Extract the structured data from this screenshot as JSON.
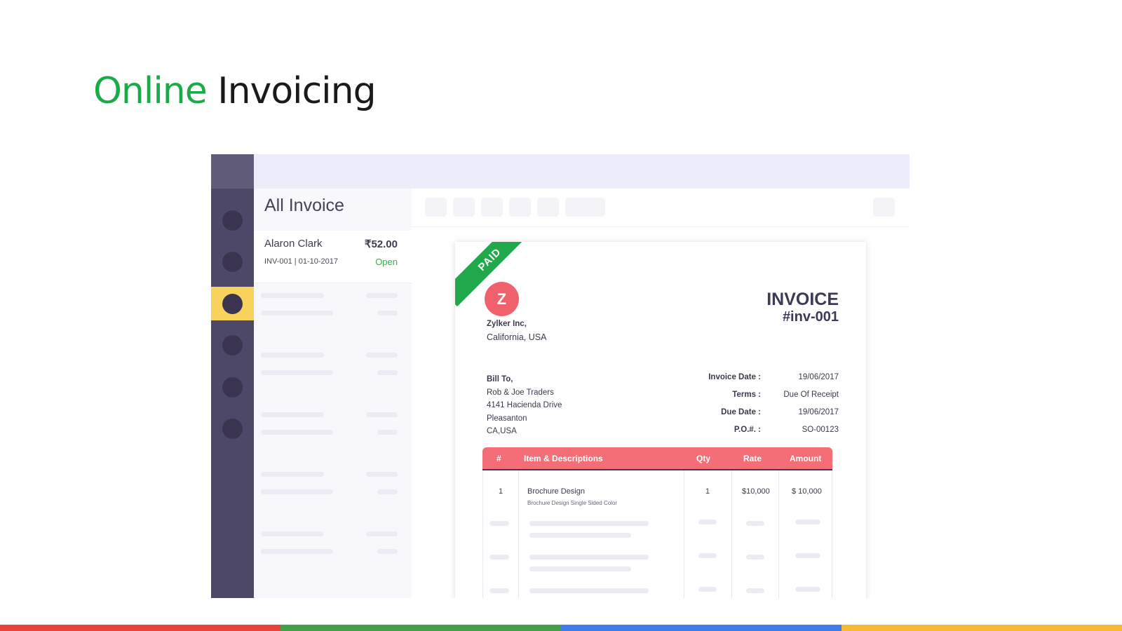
{
  "slide": {
    "title_word_1": "Online",
    "title_word_2": "Invoicing",
    "accent_color": "#1aab48",
    "bottom_bar_colors": [
      "#e8403a",
      "#43a047",
      "#3d7ee8",
      "#f6b931"
    ]
  },
  "sidebar": {
    "items": [
      {
        "icon": "nav-icon",
        "active": false
      },
      {
        "icon": "nav-icon",
        "active": false
      },
      {
        "icon": "nav-icon",
        "active": true
      },
      {
        "icon": "nav-icon",
        "active": false
      },
      {
        "icon": "nav-icon",
        "active": false
      },
      {
        "icon": "nav-icon",
        "active": false
      }
    ],
    "active_color": "#f7d25c"
  },
  "invoice_list": {
    "title": "All Invoice",
    "items": [
      {
        "customer": "Alaron Clark",
        "amount": "₹52.00",
        "meta": "INV-001 | 01-10-2017",
        "status": "Open"
      }
    ]
  },
  "invoice": {
    "ribbon": "PAID",
    "logo_letter": "Z",
    "company_name": "Zylker Inc,",
    "company_location": "California, USA",
    "title": "INVOICE",
    "number": "#inv-001",
    "bill_to_label": "Bill To,",
    "bill_to_lines": [
      "Rob & Joe Traders",
      "4141 Hacienda Drive",
      "Pleasanton",
      "CA,USA"
    ],
    "meta_fields": [
      {
        "label": "Invoice Date :",
        "value": "19/06/2017"
      },
      {
        "label": "Terms :",
        "value": "Due Of Receipt"
      },
      {
        "label": "Due Date :",
        "value": "19/06/2017"
      },
      {
        "label": "P.O.#. :",
        "value": "SO-00123"
      }
    ],
    "table": {
      "headers": {
        "num": "#",
        "item": "Item & Descriptions",
        "qty": "Qty",
        "rate": "Rate",
        "amount": "Amount"
      },
      "rows": [
        {
          "num": "1",
          "item": "Brochure Design",
          "description": "Brochure Design Single Sided Color",
          "qty": "1",
          "rate": "$10,000",
          "amount": "$ 10,000"
        }
      ]
    },
    "header_color": "#f36e77"
  }
}
